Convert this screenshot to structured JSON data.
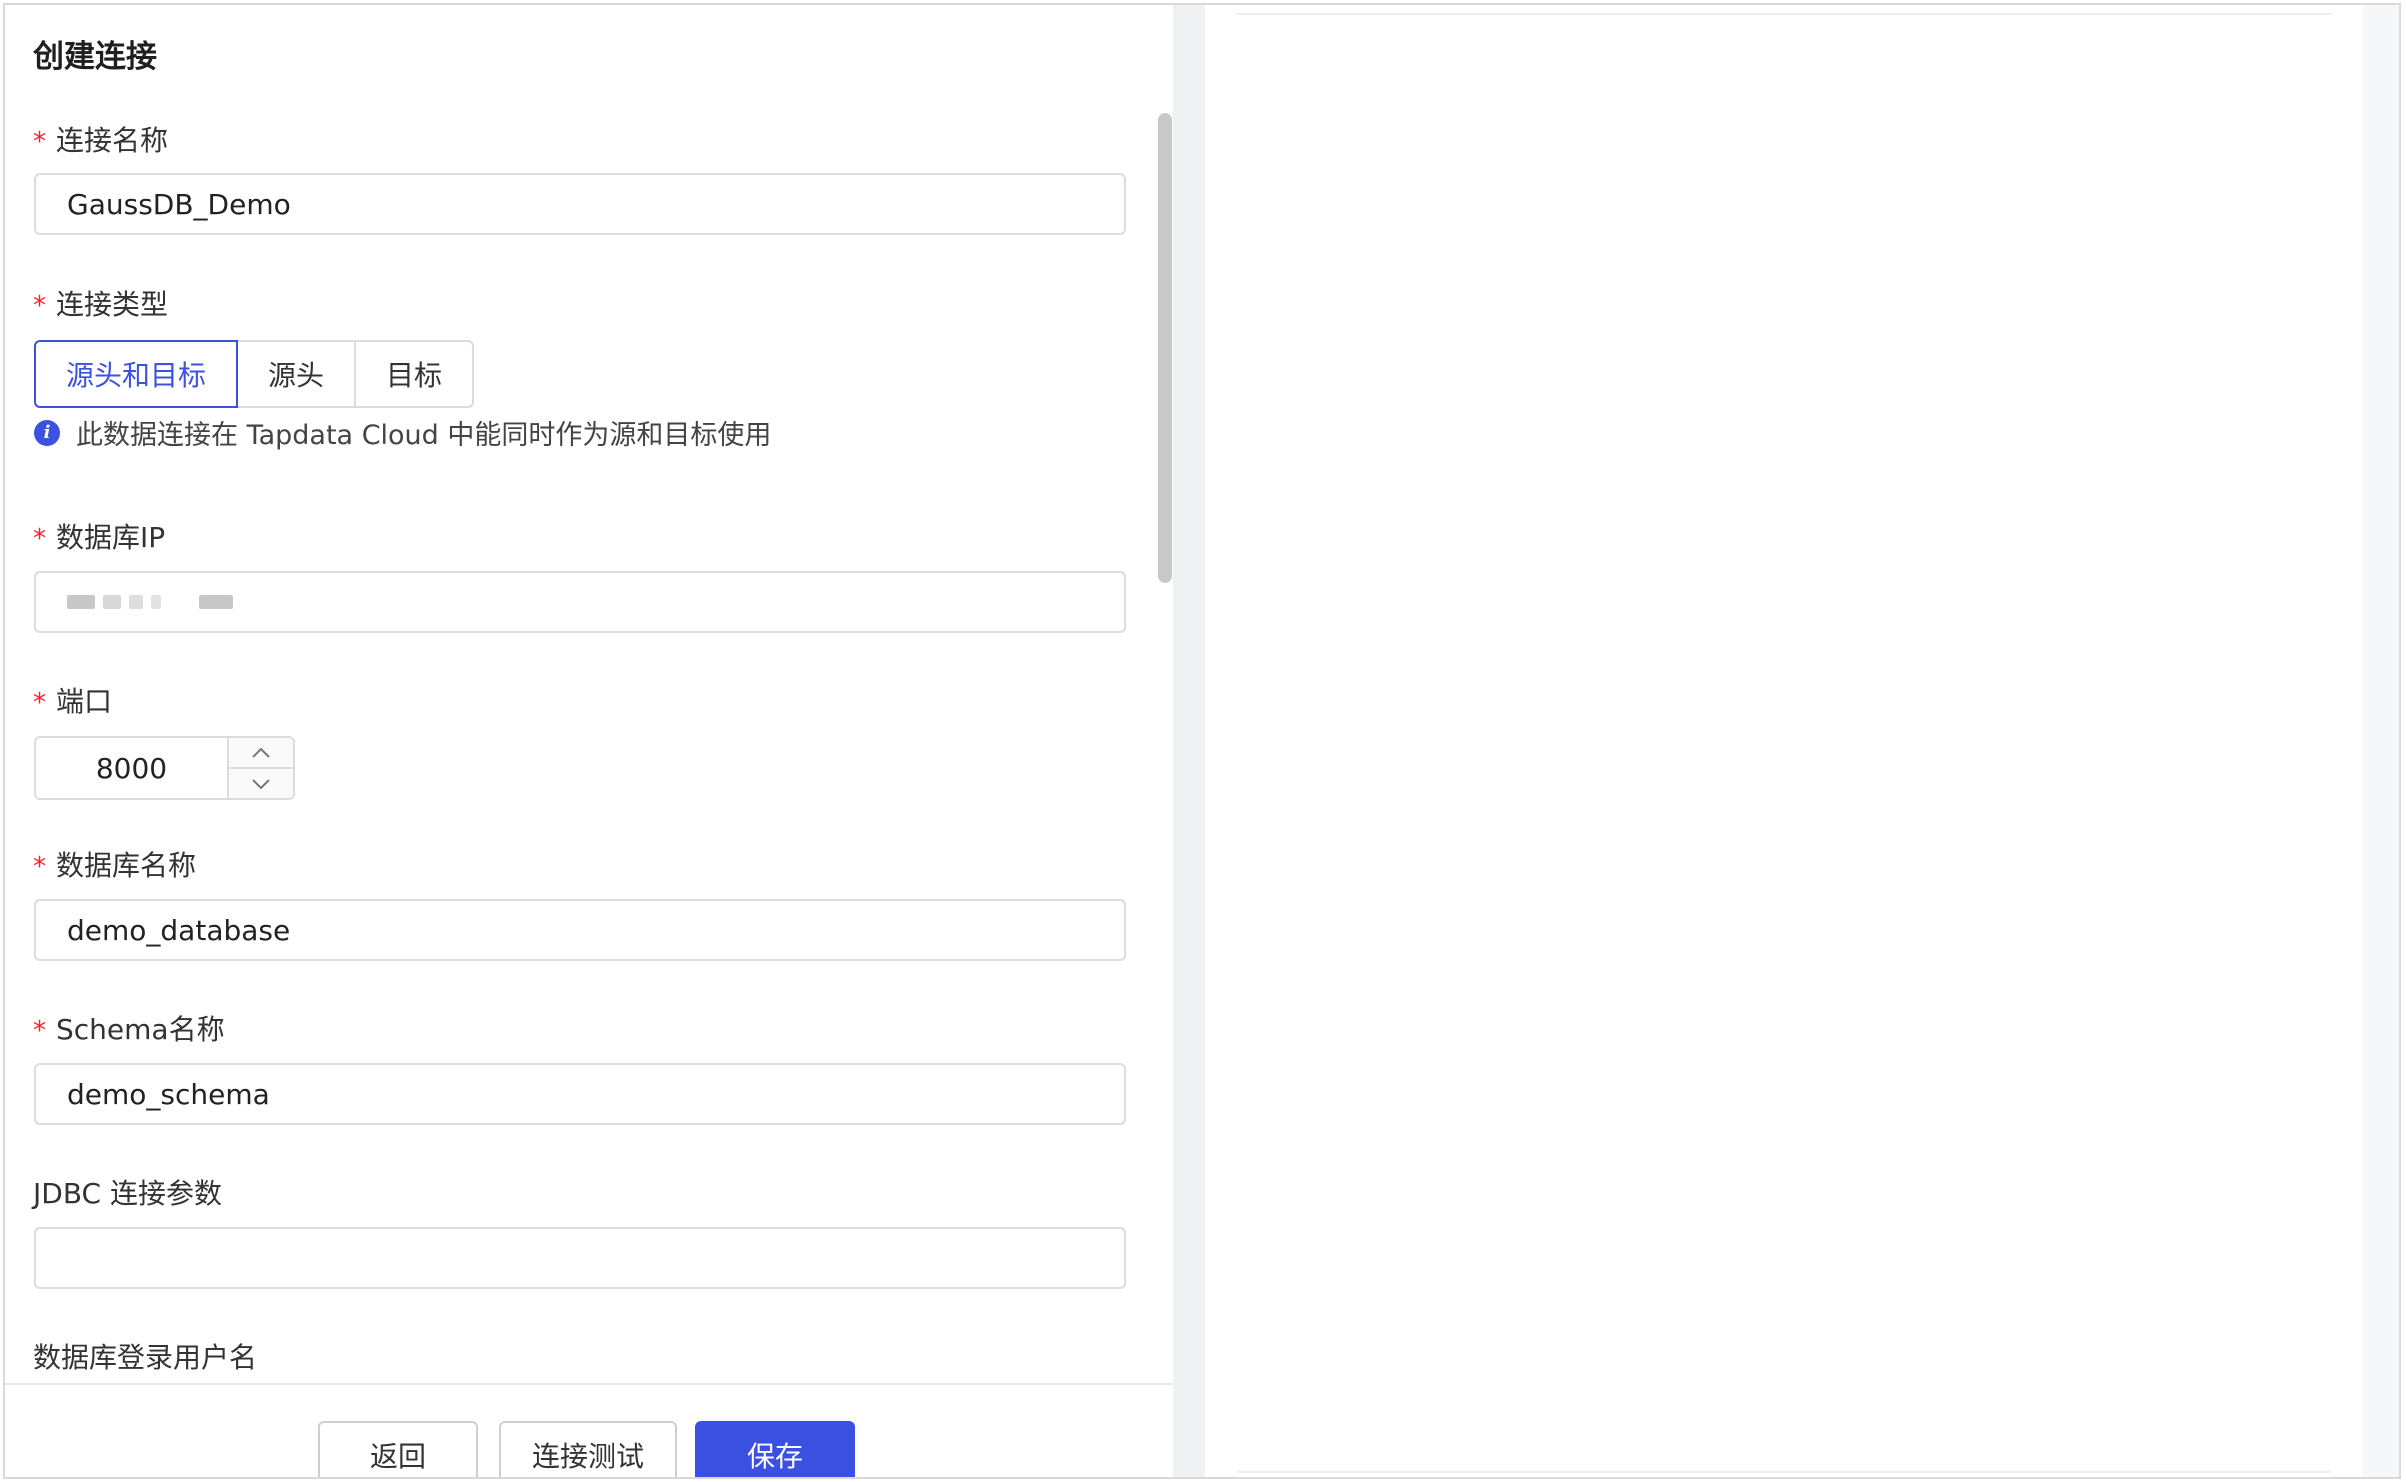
{
  "page": {
    "title": "创建连接"
  },
  "form": {
    "connection_name": {
      "label": "连接名称",
      "required": "*",
      "value": "GaussDB_Demo"
    },
    "connection_type": {
      "label": "连接类型",
      "required": "*",
      "options": [
        "源头和目标",
        "源头",
        "目标"
      ],
      "selected": "源头和目标",
      "hint": "此数据连接在 Tapdata Cloud 中能同时作为源和目标使用"
    },
    "db_ip": {
      "label": "数据库IP",
      "required": "*",
      "value_masked": true
    },
    "port": {
      "label": "端口",
      "required": "*",
      "value": "8000"
    },
    "db_name": {
      "label": "数据库名称",
      "required": "*",
      "value": "demo_database"
    },
    "schema_name": {
      "label": "Schema名称",
      "required": "*",
      "value": "demo_schema"
    },
    "jdbc_params": {
      "label": "JDBC 连接参数",
      "value": ""
    },
    "db_user": {
      "label": "数据库登录用户名"
    }
  },
  "footer": {
    "back_label": "返回",
    "test_label": "连接测试",
    "save_label": "保存"
  },
  "colors": {
    "primary": "#3b4fe0",
    "required": "#f5222d"
  },
  "icons": {
    "hint": "info-icon",
    "step_up": "chevron-up-icon",
    "step_down": "chevron-down-icon"
  }
}
